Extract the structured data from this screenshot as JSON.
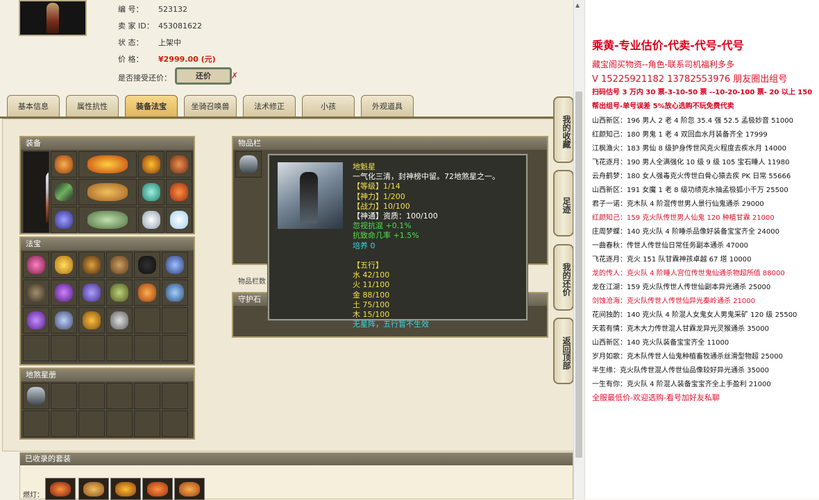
{
  "seller_info": {
    "id_label": "编 号：",
    "id_value": "523132",
    "seller_label": "卖 家 ID：",
    "seller_value": "453081622",
    "status_label": "状 态：",
    "status_value": "上架中",
    "price_label": "价 格：",
    "price_value": "¥2999.00 (元)",
    "counter_label": "是否接受还价：",
    "counter_button": "还价",
    "counter_mark": "✗"
  },
  "tabs": [
    "基本信息",
    "属性抗性",
    "装备法宝",
    "坐骑召唤兽",
    "法术修正",
    "小孩",
    "外观道具"
  ],
  "active_tab": "装备法宝",
  "panels": {
    "equipment": "装备",
    "fabao": "法宝",
    "disha": "地煞星册",
    "items": "物品栏",
    "item_col_caption": "物品栏数",
    "guard": "守护石",
    "collected": "已收录的套装",
    "bottom_label": "燃灯："
  },
  "side_nav": [
    "我的收藏",
    "足迹",
    "我的还价",
    "返回顶部"
  ],
  "tooltip": {
    "name": "地魁星",
    "desc": "一气化三清，封神榜中留。72地煞星之一。",
    "stats": [
      "【等级】1/14",
      "【神力】1/200",
      "【战力】10/100",
      "【神通】资质：100/100"
    ],
    "bonuses": [
      "忽视抗混 +0.1%",
      "抗致命几率 +1.5%"
    ],
    "cultivate": "培养 0",
    "wuxing_title": "【五行】",
    "wuxing": [
      "水 42/100",
      "火 11/100",
      "金 88/100",
      "土 75/100",
      "木 15/100"
    ],
    "footer": "无星阵，五行暂不生效"
  },
  "right_text": [
    {
      "t": "乘黄-专业估价-代卖-代号-代号",
      "c": "bred",
      "size": 16
    },
    {
      "t": "藏宝阁买物资--角色-联系司机福利多多",
      "c": "red",
      "size": 12
    },
    {
      "t": "V 15225921182   13782553976 朋友圈出组号",
      "c": "red",
      "size": 13
    },
    {
      "t": "扫码估号 3 万内 30 票-3-10-50 票 --10-20-100 票- 20 以上 150",
      "c": "bred",
      "size": 10
    },
    {
      "t": "帮出组号-单号误差 5%放心选购不玩免费代卖",
      "c": "bred",
      "size": 10
    },
    {
      "t": "山西新区：196 男人 2 老 4 阶忽 35.4 强 52.5 孟极妙音 51000",
      "c": "blk",
      "size": 10
    },
    {
      "t": "红颜知己：180 男鬼 1 老 4 双回血水月装备齐全 17999",
      "c": "blk",
      "size": 10
    },
    {
      "t": "江枫渔火：183 男仙 8 级护身传世风克火程度去疾水月 14000",
      "c": "blk",
      "size": 10
    },
    {
      "t": "飞花逐月：190 男人全满强化 10 级 9 级 105 宝石睡人 11980",
      "c": "blk",
      "size": 10
    },
    {
      "t": "云舟鹤梦：180 女人强毒克火传世白骨心猿去疾 PK 日常 55666",
      "c": "blk",
      "size": 10
    },
    {
      "t": "山西新区：191 女魔 1 老 8 级功绩克水抽孟极狐小千万 25500",
      "c": "blk",
      "size": 10
    },
    {
      "t": "君子一诺：克木队 4 阶混传世男人景行仙鬼通杀 29000",
      "c": "blk",
      "size": 10
    },
    {
      "t": "红颜知己：159 克火队传世男人仙鬼 120 种植甘霖 21000",
      "c": "red",
      "size": 10
    },
    {
      "t": "庄周梦蝶：140 克火队 4 阶睡杀品像好装备宝宝齐全 24000",
      "c": "blk",
      "size": 10
    },
    {
      "t": "一曲春秋：传世人传世仙日常任务副本通杀 47000",
      "c": "blk",
      "size": 10
    },
    {
      "t": "飞花逐月：克火 151 队甘霖神孩卓越 67 塔 10000",
      "c": "blk",
      "size": 10
    },
    {
      "t": "龙的传人：克火队 4 阶睡人宫位传世鬼仙通杀物超所值 88000",
      "c": "red",
      "size": 10
    },
    {
      "t": "龙在江湖：159 克火队传世人传世仙副本异光通杀 25000",
      "c": "blk",
      "size": 10
    },
    {
      "t": "剑蚀沧海：克火队传世人传世仙异光秦岭通杀 21000",
      "c": "red",
      "size": 10
    },
    {
      "t": "花间独酌：140 克火队 4 阶混人女鬼女人男鬼采矿 120 级 25500",
      "c": "blk",
      "size": 10
    },
    {
      "t": "天若有情：克木大力传世混人甘霖龙异光灵猴通杀 35000",
      "c": "blk",
      "size": 10
    },
    {
      "t": "山西新区：140 克火队装备宝宝齐全 11000",
      "c": "blk",
      "size": 10
    },
    {
      "t": "岁月如歌：克木队传世人仙鬼种植畜牧通杀丝滑型物超 25000",
      "c": "blk",
      "size": 10
    },
    {
      "t": "半生缘：克火队传世混人传世仙品像较好异光通杀 35000",
      "c": "blk",
      "size": 10
    },
    {
      "t": "一生有你：克火队 4 阶混人装备宝宝齐全上手盈利 21000",
      "c": "blk",
      "size": 10
    },
    {
      "t": "全服最低价-欢迎选购-看号加好友私聊",
      "c": "red",
      "size": 11
    }
  ]
}
